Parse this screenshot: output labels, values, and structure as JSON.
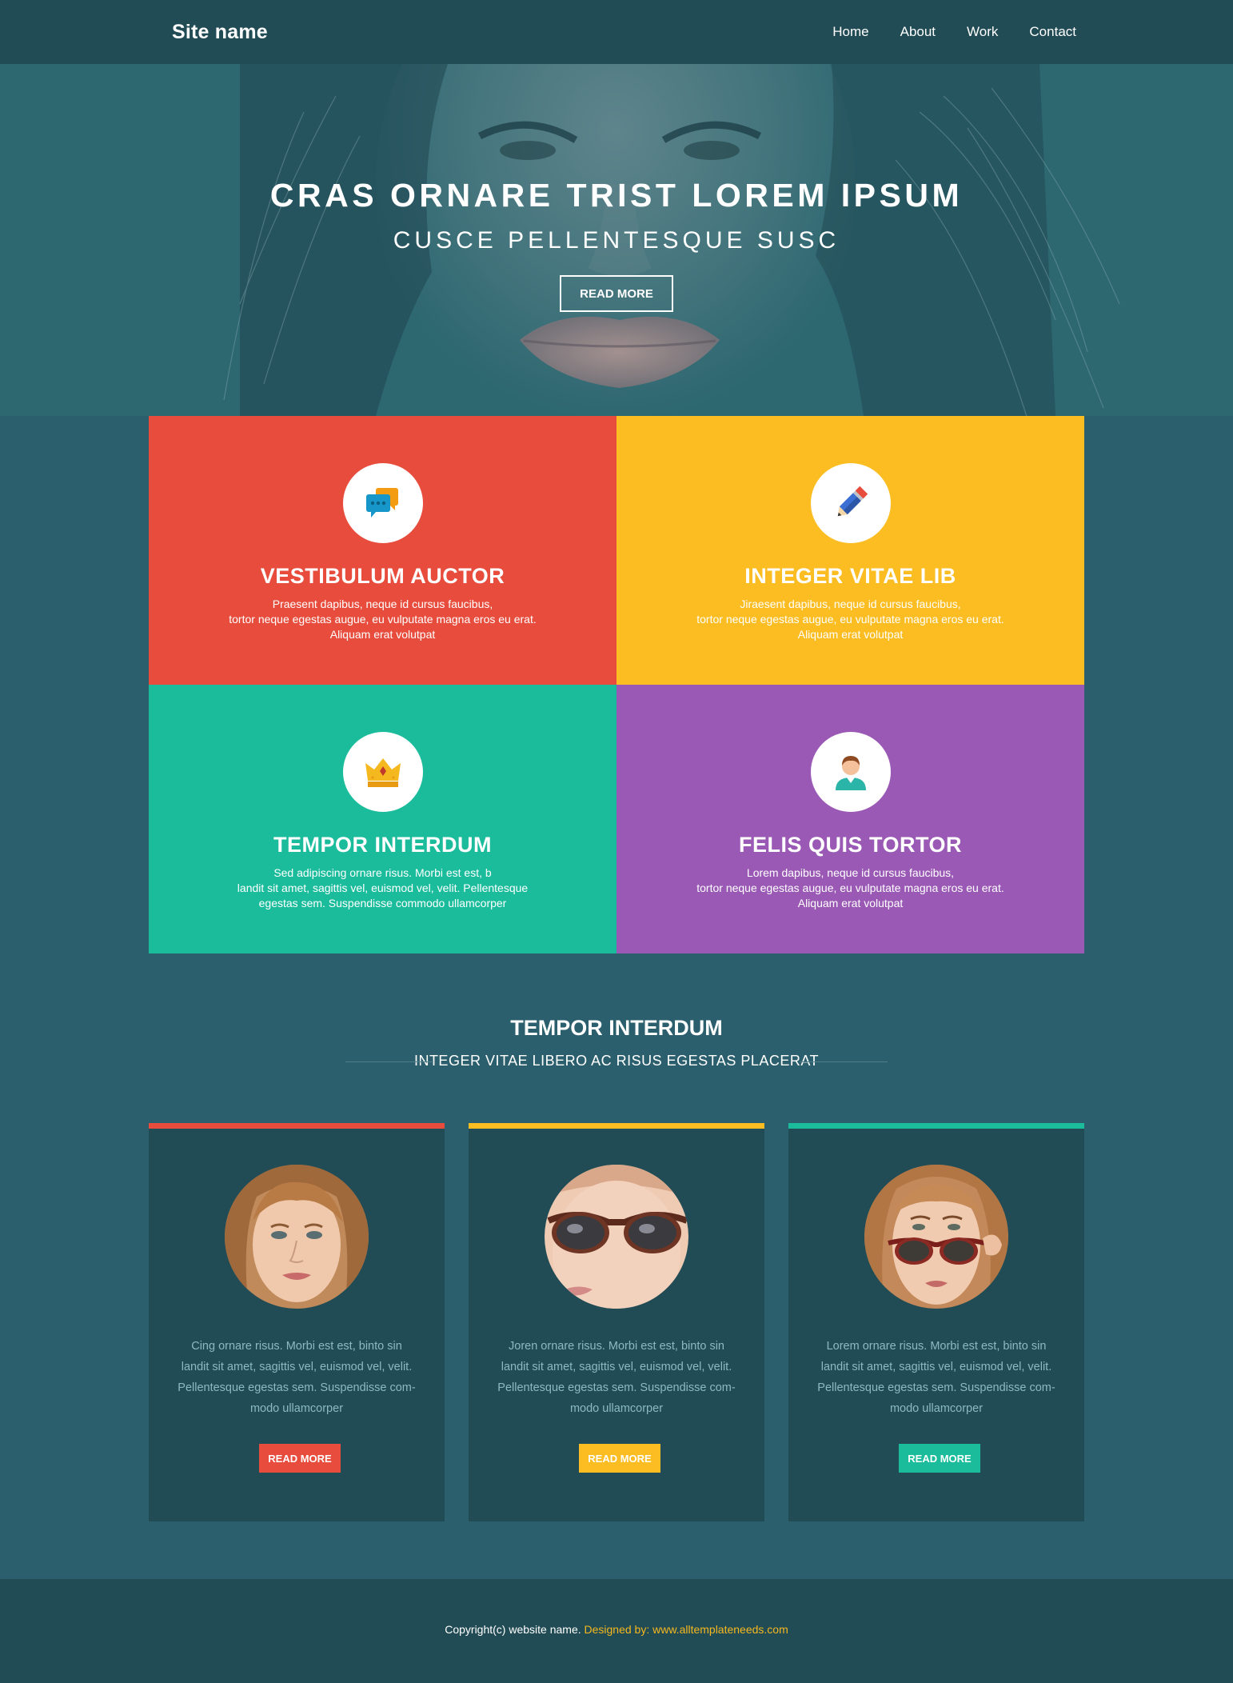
{
  "nav": {
    "site_name": "Site name",
    "links": [
      "Home",
      "About",
      "Work",
      "Contact"
    ]
  },
  "hero": {
    "title": "CRAS ORNARE TRIST LOREM IPSUM",
    "subtitle": "CUSCE PELLENTESQUE SUSC",
    "button": "READ MORE"
  },
  "features": [
    {
      "title": "VESTIBULUM AUCTOR",
      "lines": [
        "Praesent dapibus, neque id cursus faucibus,",
        "tortor neque egestas augue, eu vulputate magna eros eu erat.",
        "Aliquam erat volutpat"
      ],
      "color": "#e74c3c",
      "icon": "chat-bubbles-icon"
    },
    {
      "title": "INTEGER VITAE LIB",
      "lines": [
        "Jiraesent dapibus, neque id cursus faucibus,",
        "tortor neque egestas augue, eu vulputate magna eros eu erat.",
        "Aliquam erat volutpat"
      ],
      "color": "#fbbd21",
      "icon": "pencil-icon"
    },
    {
      "title": "TEMPOR INTERDUM",
      "lines": [
        "Sed adipiscing ornare risus. Morbi est est, b",
        "landit sit amet, sagittis vel, euismod vel, velit. Pellentesque",
        "egestas sem. Suspendisse commodo ullamcorper"
      ],
      "color": "#1abc9c",
      "icon": "crown-icon"
    },
    {
      "title": "FELIS QUIS TORTOR",
      "lines": [
        "Lorem dapibus, neque id cursus faucibus,",
        "tortor neque egestas augue, eu vulputate magna eros eu erat.",
        "Aliquam erat volutpat"
      ],
      "color": "#9b59b6",
      "icon": "user-icon"
    }
  ],
  "section": {
    "title": "TEMPOR INTERDUM",
    "subtitle": "INTEGER VITAE LIBERO AC RISUS EGESTAS PLACERAT"
  },
  "cards": [
    {
      "lines": [
        "Cing ornare risus. Morbi est est, binto sin",
        "landit sit amet, sagittis vel, euismod vel, velit.",
        "Pellentesque  egestas sem. Suspendisse com-",
        "modo ullamcorper"
      ],
      "button": "READ MORE",
      "color": "#e74c3c"
    },
    {
      "lines": [
        "Joren ornare risus. Morbi est est, binto sin",
        "landit sit amet, sagittis vel, euismod vel, velit.",
        "Pellentesque  egestas sem. Suspendisse com-",
        "modo ullamcorper"
      ],
      "button": "READ MORE",
      "color": "#fbbd21"
    },
    {
      "lines": [
        "Lorem ornare risus. Morbi est est, binto sin",
        "landit sit amet, sagittis vel, euismod vel, velit.",
        "Pellentesque  egestas sem. Suspendisse com-",
        "modo ullamcorper"
      ],
      "button": "READ MORE",
      "color": "#1abc9c"
    }
  ],
  "footer": {
    "copyright": "Copyright(c) website name.",
    "designed_by": "Designed by: www.alltemplateneeds.com"
  }
}
